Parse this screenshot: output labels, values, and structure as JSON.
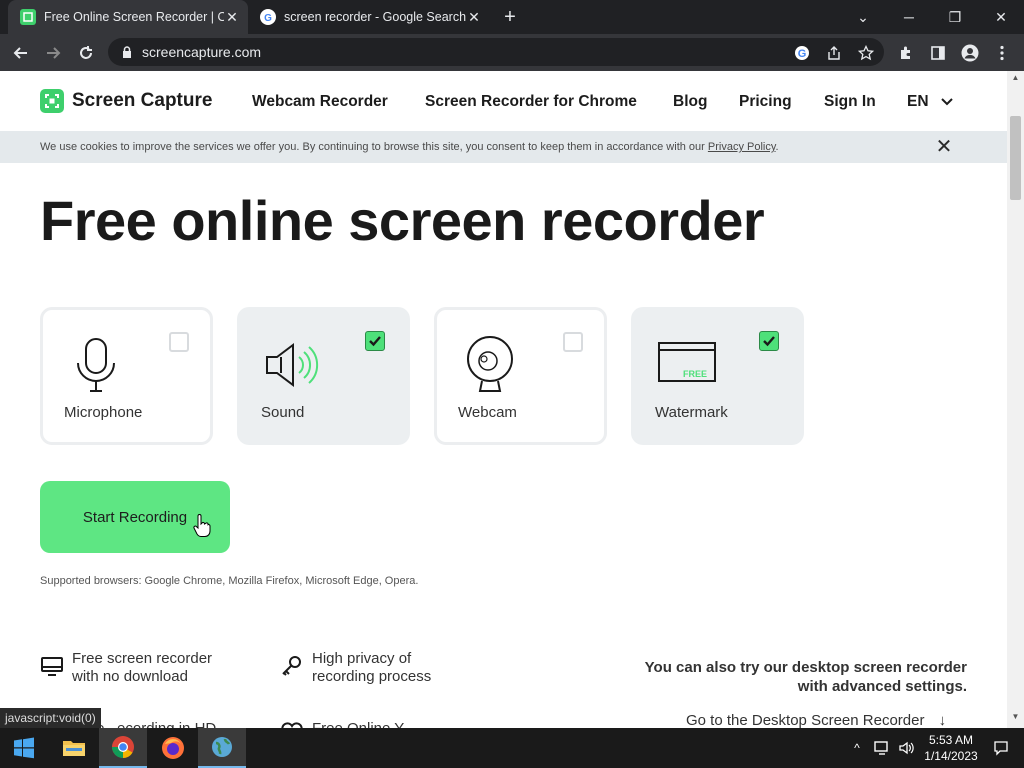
{
  "browser": {
    "tabs": [
      {
        "title": "Free Online Screen Recorder | Or",
        "close": "✕"
      },
      {
        "title": "screen recorder - Google Search",
        "close": "✕"
      }
    ],
    "new_tab": "+",
    "window_controls": {
      "chevron": "⌄",
      "minimize": "─",
      "restore": "❐",
      "close": "✕"
    },
    "url": "screencapture.com",
    "status_url": "javascript:void(0)"
  },
  "site": {
    "logo_text": "Screen Capture",
    "nav": {
      "webcam": "Webcam Recorder",
      "chrome": "Screen Recorder for Chrome",
      "blog": "Blog",
      "pricing": "Pricing",
      "signin": "Sign In",
      "lang": "EN",
      "lang_chevron": "⌄"
    },
    "cookie": {
      "message": "We use cookies to improve the services we offer you. By continuing to browse this site, you consent to keep them in accordance with our",
      "link": "Privacy Policy",
      "end": ".",
      "close": "✕"
    },
    "hero_title": "Free online screen recorder",
    "options": [
      {
        "label": "Microphone",
        "checked": false,
        "icon": "microphone-icon"
      },
      {
        "label": "Sound",
        "checked": true,
        "icon": "speaker-icon"
      },
      {
        "label": "Webcam",
        "checked": false,
        "icon": "webcam-icon"
      },
      {
        "label": "Watermark",
        "checked": true,
        "icon": "watermark-icon",
        "badge": "FREE"
      }
    ],
    "start_button": "Start Recording",
    "supported": "Supported browsers: Google Chrome, Mozilla Firefox, Microsoft Edge, Opera.",
    "features": [
      {
        "line1": "Free screen recorder",
        "line2": "with no download",
        "icon": "monitor-icon"
      },
      {
        "line1": "High privacy of",
        "line2": "recording process",
        "icon": "key-icon"
      },
      {
        "line1": "...ide...ecording in HD",
        "icon": "video-icon"
      },
      {
        "line1": "Free Online Y...",
        "icon": "heart-icon"
      }
    ],
    "desktop_promo": {
      "line1": "You can also try our desktop screen recorder",
      "line2": "with advanced settings.",
      "link": "Go to the Desktop Screen Recorder",
      "arrow": "↓"
    },
    "colors": {
      "accent": "#5ee683",
      "check": "#4ee07a",
      "text": "#1a1a1a"
    }
  },
  "taskbar": {
    "time": "5:53 AM",
    "date": "1/14/2023",
    "tray_chevron": "^"
  }
}
